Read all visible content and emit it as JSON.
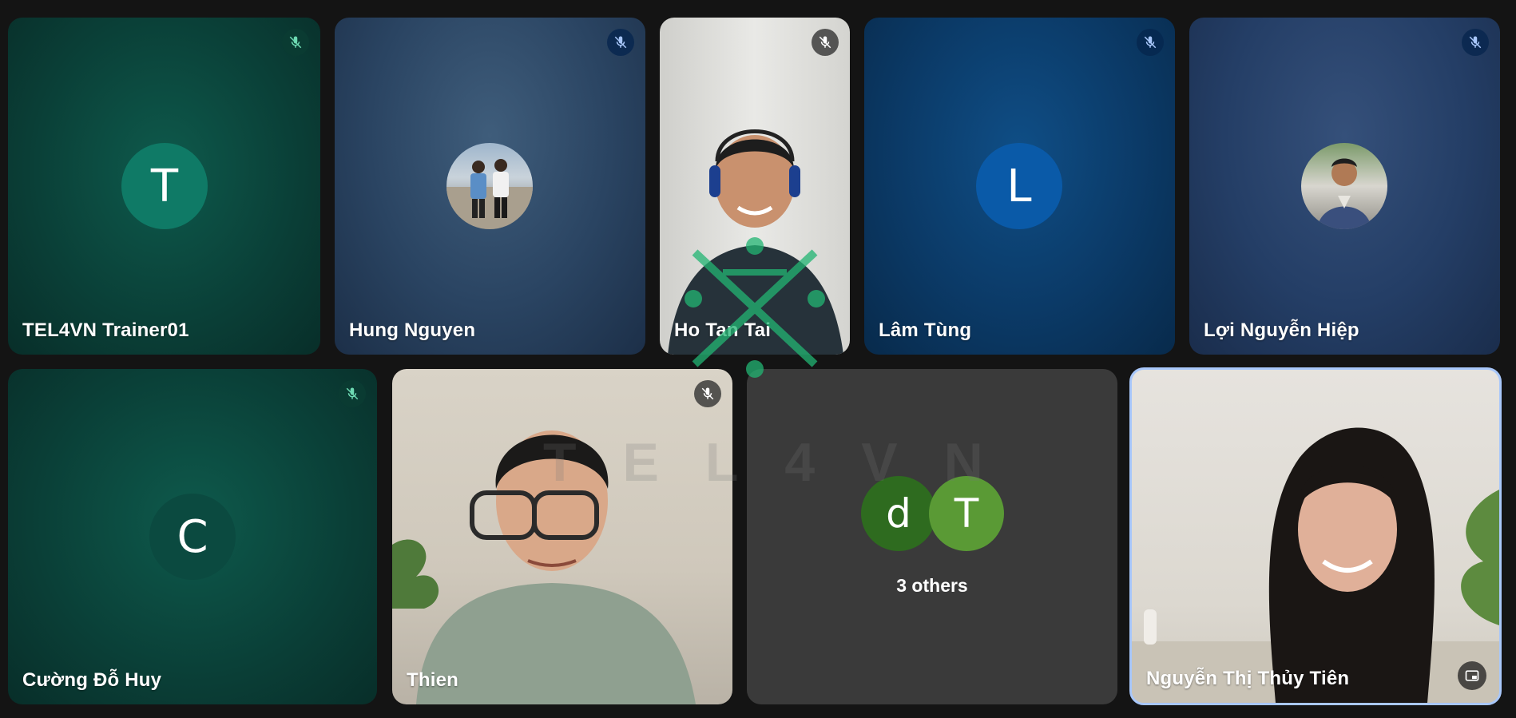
{
  "participants": [
    {
      "name": "TEL4VN Trainer01",
      "initial": "T",
      "muted": true
    },
    {
      "name": "Hung Nguyen",
      "muted": true,
      "avatar_icon": "person-photo"
    },
    {
      "name": "Ho Tan Tai",
      "muted": true,
      "video_icon": "camera-video"
    },
    {
      "name": "Lâm Tùng",
      "initial": "L",
      "muted": true
    },
    {
      "name": "Lợi Nguyễn Hiệp",
      "muted": true,
      "avatar_icon": "person-photo"
    },
    {
      "name": "Cường Đỗ Huy",
      "initial": "C",
      "muted": true
    },
    {
      "name": "Thien",
      "muted": true,
      "video_icon": "camera-video"
    },
    {
      "name": "Nguyễn Thị Thủy Tiên",
      "muted": false,
      "video_icon": "camera-video",
      "active_speaker": true
    }
  ],
  "others": {
    "label": "3 others",
    "initials": [
      "d",
      "T"
    ]
  },
  "watermark": {
    "text": "TEL4VN"
  },
  "icons": {
    "mic_off": "mic-off-icon",
    "pip": "picture-in-picture-icon"
  },
  "colors": {
    "tile_green": "#0a3f37",
    "tile_blue": "#2a4462",
    "tile_navy": "#0b3a67",
    "others_bg": "#3a3a3a",
    "active_border": "#a8c7fa",
    "avatar_d": "#2e6b1f",
    "avatar_T2": "#5a9a35"
  }
}
